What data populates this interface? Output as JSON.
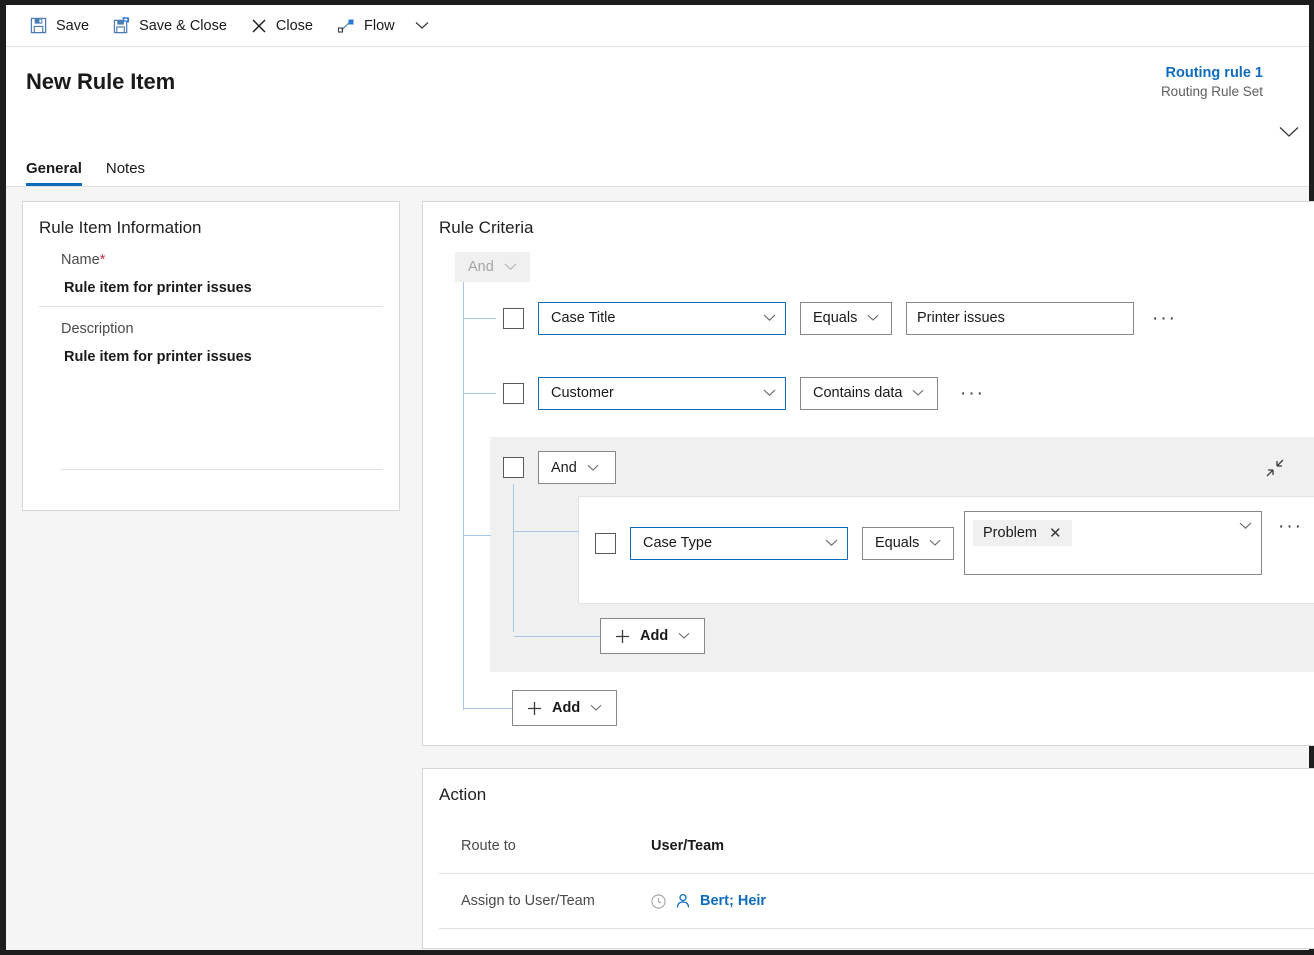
{
  "toolbar": {
    "items": [
      {
        "label": "Save",
        "icon": "save-icon"
      },
      {
        "label": "Save & Close",
        "icon": "save-and-close-icon"
      },
      {
        "label": "Close",
        "icon": "close-x-icon"
      },
      {
        "label": "Flow",
        "icon": "flow-icon"
      }
    ],
    "overflow_caret": "chevron-down-icon"
  },
  "header": {
    "title": "New Rule Item",
    "context": {
      "name": "Routing rule 1",
      "entity": "Routing Rule Set"
    },
    "tabs": [
      {
        "label": "General",
        "active": true
      },
      {
        "label": "Notes",
        "active": false
      }
    ]
  },
  "rule_item_information": {
    "title": "Rule Item Information",
    "fields": [
      {
        "label": "Name",
        "required": "*",
        "value": "Rule item for printer issues"
      },
      {
        "label": "Description",
        "required": "",
        "value": "Rule item for printer issues"
      }
    ]
  },
  "rule_criteria": {
    "title": "Rule Criteria",
    "root_operator": "And",
    "rows": [
      {
        "attribute": "Case Title",
        "operator": "Equals",
        "value": "Printer issues",
        "more": "···"
      },
      {
        "attribute": "Customer",
        "operator": "Contains data",
        "value": "",
        "more": "···"
      }
    ],
    "group": {
      "operator": "And",
      "collapse_icon": "collapse-diagonal-icon",
      "more": "···",
      "rows": [
        {
          "attribute": "Case Type",
          "operator": "Equals",
          "tag": "Problem",
          "tag_remove": "✕",
          "more": "···"
        }
      ],
      "add_label": "Add"
    },
    "add_label": "Add"
  },
  "action": {
    "title": "Action",
    "rows": [
      {
        "label": "Route to",
        "value": "User/Team",
        "type": "text"
      },
      {
        "label": "Assign to User/Team",
        "value": "Bert; Heir",
        "type": "lookup"
      }
    ]
  },
  "colors": {
    "accent": "#0f6cbd",
    "required": "#c4314b",
    "tree_line": "#a9c7ea",
    "group_bg": "#f0f0f0",
    "page_bg": "#f5f5f5"
  }
}
